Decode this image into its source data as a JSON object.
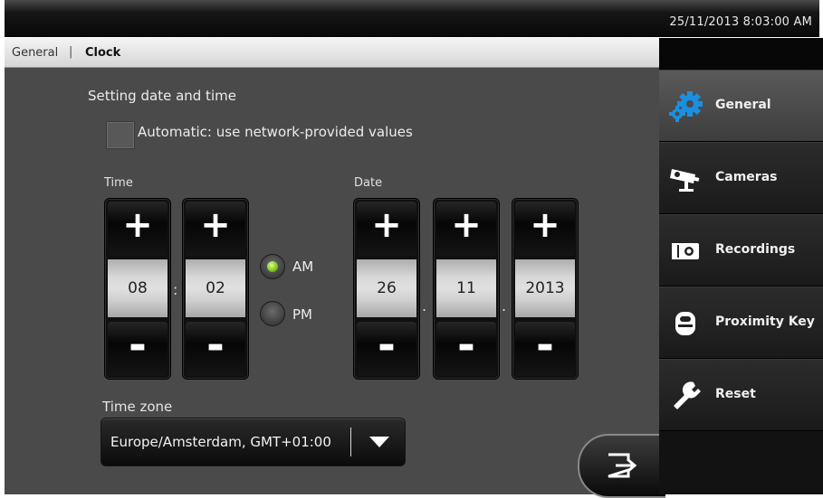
{
  "status": {
    "datetime": "25/11/2013 8:03:00 AM"
  },
  "breadcrumb": {
    "parent": "General",
    "separator": "|",
    "current": "Clock"
  },
  "clock": {
    "title": "Setting date and time",
    "automatic": {
      "label": "Automatic: use network-provided values",
      "checked": false
    },
    "time_label": "Time",
    "date_label": "Date",
    "plus": "+",
    "minus": "-",
    "time": {
      "hour": "08",
      "separator": ":",
      "minute": "02"
    },
    "date": {
      "day": "26",
      "month": "11",
      "year": "2013",
      "separator": "."
    },
    "ampm": {
      "am_label": "AM",
      "pm_label": "PM",
      "selected": "AM"
    },
    "timezone": {
      "label": "Time zone",
      "value": "Europe/Amsterdam, GMT+01:00"
    }
  },
  "sidebar": {
    "items": [
      {
        "label": "General",
        "icon": "gears-icon",
        "active": true
      },
      {
        "label": "Cameras",
        "icon": "camera-icon",
        "active": false
      },
      {
        "label": "Recordings",
        "icon": "recording-icon",
        "active": false
      },
      {
        "label": "Proximity Key",
        "icon": "proximity-key-icon",
        "active": false
      },
      {
        "label": "Reset",
        "icon": "wrench-icon",
        "active": false
      }
    ]
  },
  "colors": {
    "accent_blue": "#1b8fe0",
    "radio_green": "#7fc21c",
    "content_bg": "#4a4a4a"
  }
}
